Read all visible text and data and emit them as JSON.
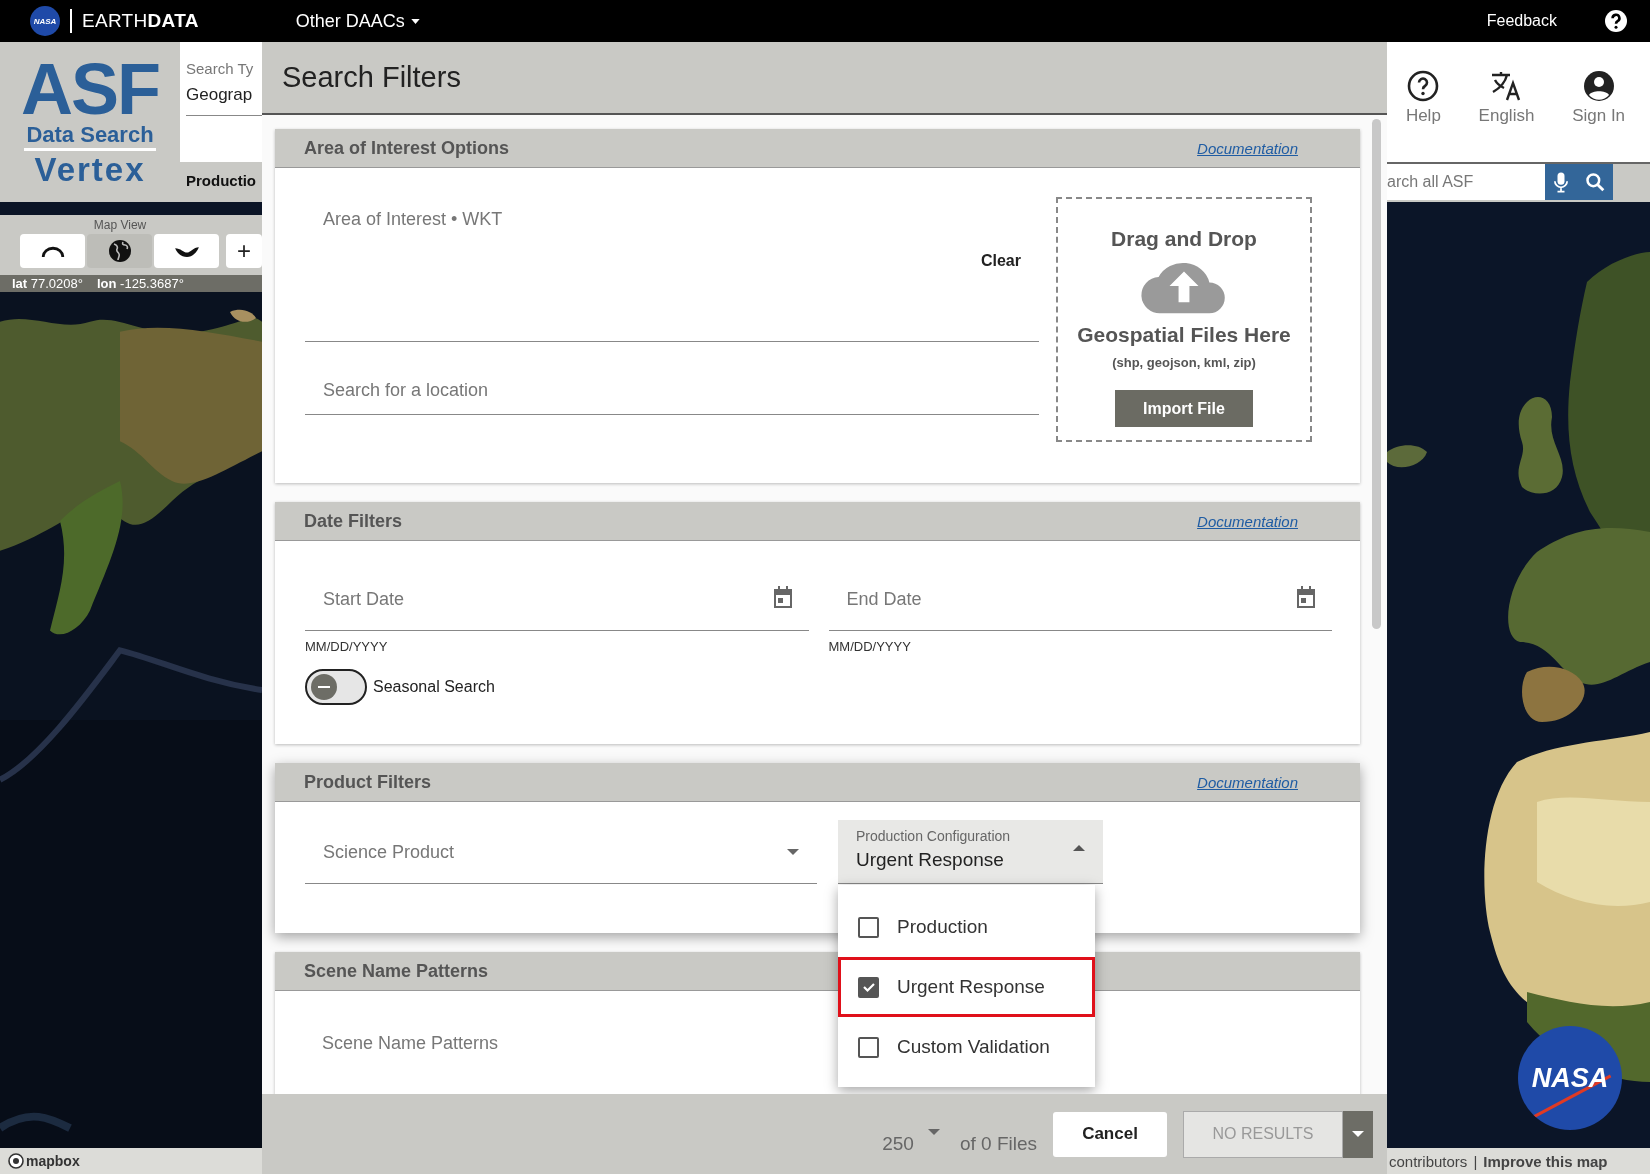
{
  "topbar": {
    "logo": "NASA",
    "brand": "EARTH**DATA**",
    "menu": "Other DAACs",
    "feedback": "Feedback"
  },
  "header": {
    "logo": {
      "mark": "ASF",
      "line_1": "Data Search",
      "line_2": "Vertex"
    },
    "search_type": {
      "label": "Search Ty",
      "value": "Geograp"
    },
    "subtitle": "Productio",
    "actions": [
      {
        "kind": "help",
        "label": "Help"
      },
      {
        "kind": "language",
        "label": "English"
      },
      {
        "kind": "account",
        "label": "Sign In"
      }
    ],
    "site_search": {
      "placeholder": "arch all ASF"
    }
  },
  "map": {
    "view_label": "Map View",
    "views": [
      {
        "kind": "arctic",
        "selected": false
      },
      {
        "kind": "equatorial",
        "selected": true
      },
      {
        "kind": "antarctic",
        "selected": false
      }
    ],
    "zoom_in": "+",
    "coords": [
      "**lat** 77.0208°",
      "**lon** -125.3687°"
    ],
    "attribution": "mapbox",
    "credits": "contributors",
    "separator": "|",
    "link": "Improve this map",
    "badge": "NASA"
  },
  "modal": {
    "title": "Search Filters",
    "aoi": {
      "title": "Area of Interest Options",
      "doc_link": "Documentation",
      "wkt_label": "Area of Interest • WKT",
      "clear": "Clear",
      "location_placeholder": "Search for a location",
      "drop": {
        "heading": "Drag and Drop",
        "subheading": "Geospatial Files Here",
        "formats": "(shp, geojson, kml, zip)",
        "button": "Import File"
      }
    },
    "dates": {
      "title": "Date Filters",
      "doc_link": "Documentation",
      "fields": [
        {
          "placeholder": "Start Date",
          "hint": "MM/DD/YYYY"
        },
        {
          "placeholder": "End Date",
          "hint": "MM/DD/YYYY"
        }
      ],
      "seasonal": {
        "label": "Seasonal Search",
        "on": false
      }
    },
    "product": {
      "title": "Product Filters",
      "doc_link": "Documentation",
      "science": {
        "placeholder": "Science Product"
      },
      "config": {
        "label": "Production Configuration",
        "value": "Urgent Response",
        "expanded": true,
        "options": [
          {
            "label": "Production",
            "checked": false,
            "focused": false
          },
          {
            "label": "Urgent Response",
            "checked": true,
            "focused": true
          },
          {
            "label": "Custom Validation",
            "checked": false,
            "focused": false
          }
        ]
      }
    },
    "scene": {
      "title": "Scene Name Patterns",
      "placeholder": "Scene Name Patterns"
    },
    "footer": {
      "page_size": "250",
      "count": "of 0 Files",
      "cancel": "Cancel",
      "search": "NO RESULTS",
      "search_disabled": true
    }
  }
}
